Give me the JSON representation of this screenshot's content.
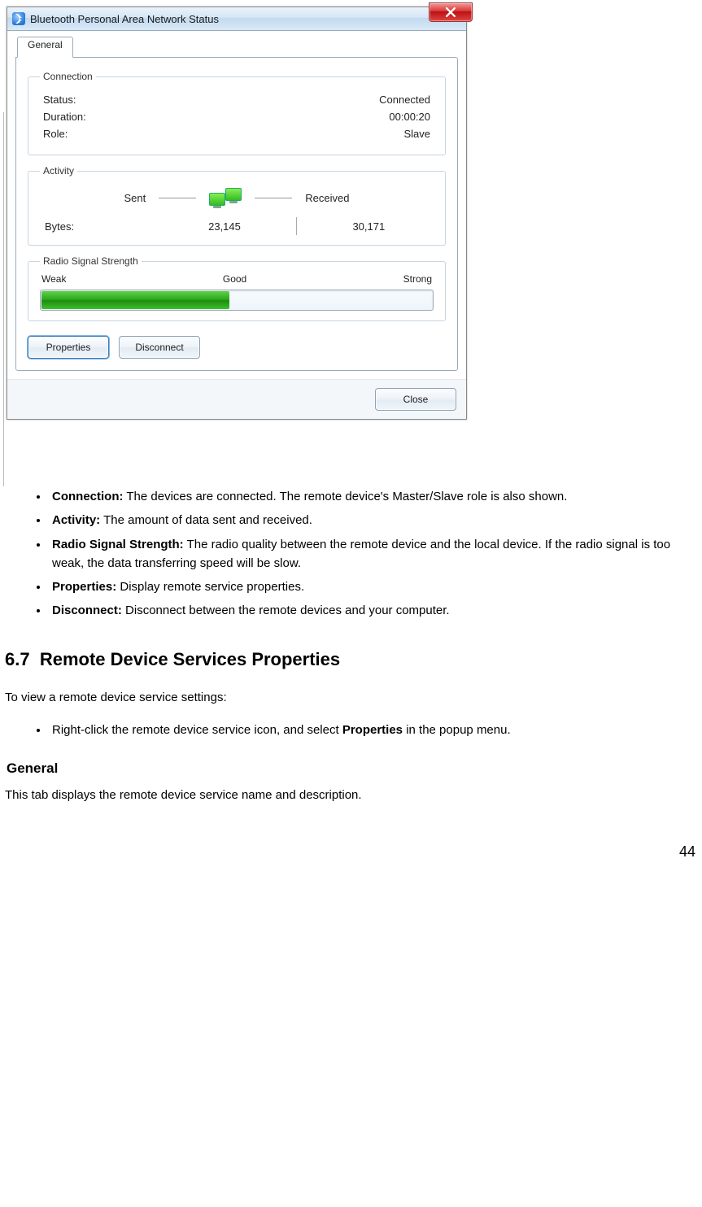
{
  "dialog": {
    "title": "Bluetooth Personal Area Network Status",
    "tab_label": "General",
    "connection": {
      "legend": "Connection",
      "status_label": "Status:",
      "status_value": "Connected",
      "duration_label": "Duration:",
      "duration_value": "00:00:20",
      "role_label": "Role:",
      "role_value": "Slave"
    },
    "activity": {
      "legend": "Activity",
      "sent_label": "Sent",
      "received_label": "Received",
      "bytes_label": "Bytes:",
      "sent_value": "23,145",
      "received_value": "30,171"
    },
    "signal": {
      "legend": "Radio Signal Strength",
      "weak": "Weak",
      "good": "Good",
      "strong": "Strong"
    },
    "buttons": {
      "properties": "Properties",
      "disconnect": "Disconnect",
      "close": "Close"
    }
  },
  "doc": {
    "bullets1": [
      {
        "term": "Connection:",
        "text": " The devices are connected. The remote device's Master/Slave role is also shown."
      },
      {
        "term": "Activity:",
        "text": " The amount of data sent and received."
      },
      {
        "term": "Radio Signal Strength:",
        "text": " The radio quality between the remote device and the local device. If the radio signal is too weak, the data transferring speed will be slow."
      },
      {
        "term": "Properties:",
        "text": " Display remote service properties."
      },
      {
        "term": "Disconnect:",
        "text": " Disconnect between the remote devices and your computer."
      }
    ],
    "section_num": "6.7",
    "section_title": "Remote Device Services Properties",
    "intro": "To view a remote device service settings:",
    "bullets2_pre": "Right-click the remote device service icon, and select ",
    "bullets2_bold": "Properties",
    "bullets2_post": " in the popup menu.",
    "sub_heading": "General",
    "sub_text": "This tab displays the remote device service name and description.",
    "page_number": "44"
  }
}
